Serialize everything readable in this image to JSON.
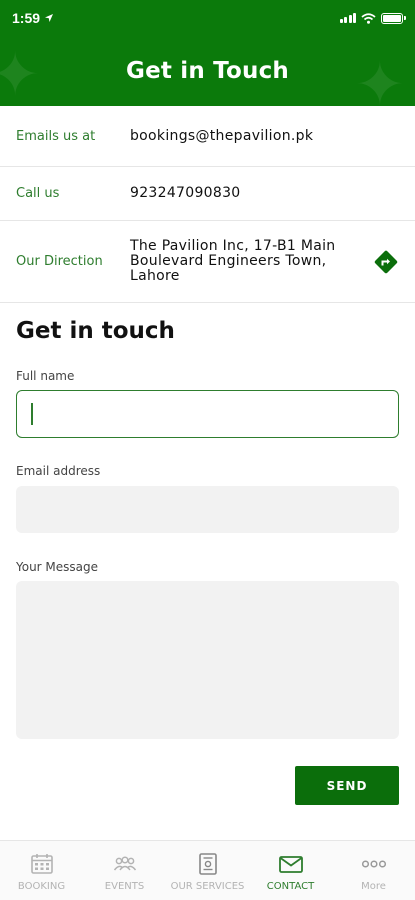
{
  "status_bar": {
    "time": "1:59"
  },
  "header": {
    "title": "Get in Touch"
  },
  "contact_info": [
    {
      "label": "Emails us at",
      "value": "bookings@thepavilion.pk"
    },
    {
      "label": "Call us",
      "value": "923247090830"
    },
    {
      "label": "Our Direction",
      "value_lines": [
        "The Pavilion Inc, 17-B1 Main",
        "Boulevard Engineers Town,",
        "Lahore"
      ]
    }
  ],
  "form": {
    "title": "Get in touch",
    "full_name_label": "Full name",
    "full_name_value": "",
    "email_label": "Email address",
    "email_value": "",
    "message_label": "Your Message",
    "message_value": "",
    "send_label": "SEND"
  },
  "tabs": [
    {
      "label": "BOOKING",
      "icon": "calendar-icon",
      "active": false
    },
    {
      "label": "EVENTS",
      "icon": "people-icon",
      "active": false
    },
    {
      "label": "OUR SERVICES",
      "icon": "services-icon",
      "active": false
    },
    {
      "label": "CONTACT",
      "icon": "mail-icon",
      "active": true
    },
    {
      "label": "More",
      "icon": "more-icon",
      "active": false
    }
  ],
  "colors": {
    "brand_green": "#0b7a0b",
    "label_green": "#2e7d2e",
    "inactive_tab": "#b3b3b3"
  }
}
